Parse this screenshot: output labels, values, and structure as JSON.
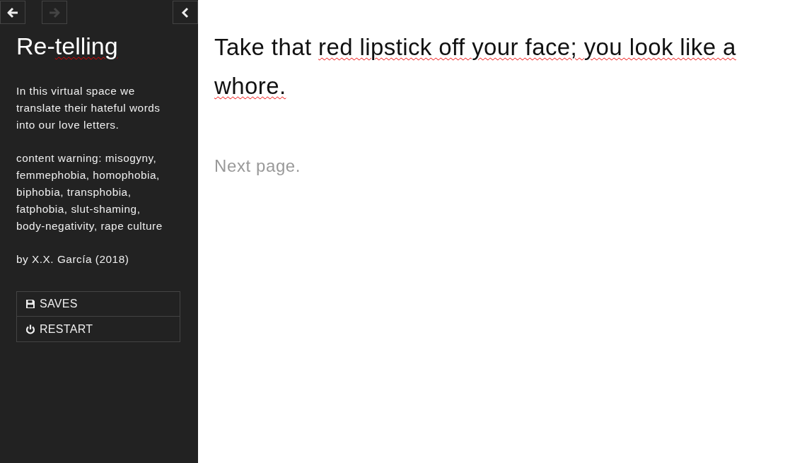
{
  "ui_bar": {
    "history": [
      {
        "kind": "back",
        "disabled": false
      },
      {
        "kind": "forward",
        "disabled": true
      }
    ],
    "toggle": {
      "kind": "collapse"
    }
  },
  "story": {
    "title": [
      {
        "text": "Re-",
        "marked": false
      },
      {
        "text": "telling",
        "marked": true
      }
    ],
    "paragraphs": [
      "In this virtual space we translate their hateful words into our love letters.",
      "content warning: misogyny, femmephobia, homophobia, biphobia, transphobia, fatphobia, slut-shaming, body-negativity, rape culture",
      "by X.X. García (2018)"
    ]
  },
  "menu": [
    {
      "kind": "saves",
      "label": "SAVES"
    },
    {
      "kind": "restart",
      "label": "RESTART"
    }
  ],
  "passage": {
    "text": [
      {
        "text": "Take that ",
        "marked": false
      },
      {
        "text": "red lipstick off your face; you look like a whore.",
        "marked": true
      }
    ],
    "link": {
      "label": "Next page.",
      "visited": false
    }
  }
}
